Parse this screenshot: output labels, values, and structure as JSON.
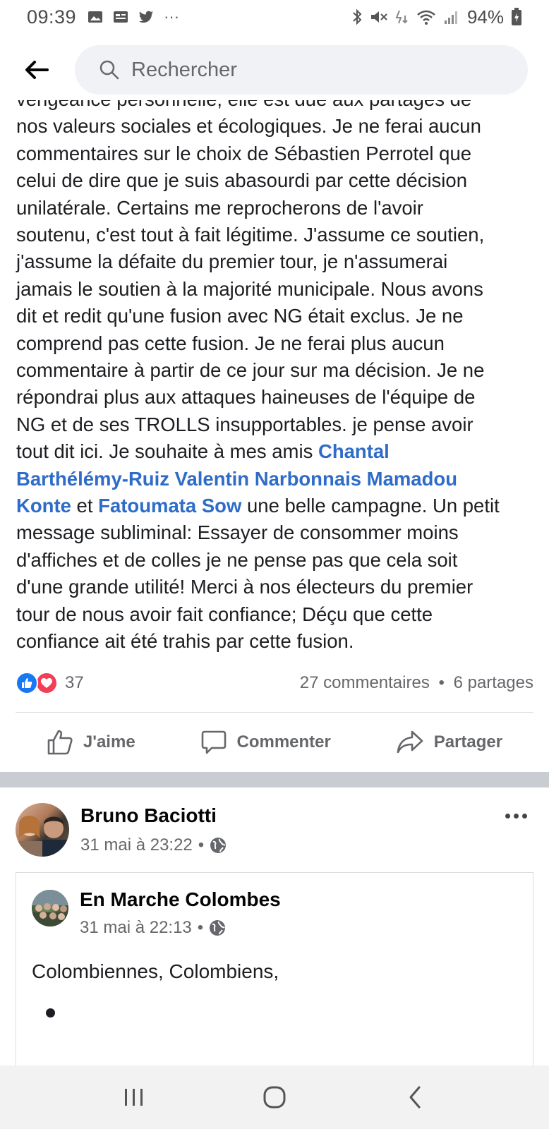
{
  "status_bar": {
    "time": "09:39",
    "left_icons": [
      "image-icon",
      "news-icon",
      "twitter-icon",
      "more-dots-icon"
    ],
    "more": "···",
    "right_icons": [
      "bluetooth-icon",
      "mute-icon",
      "data-icon",
      "wifi-icon",
      "signal-icon",
      "battery-icon"
    ],
    "battery": "94%"
  },
  "header": {
    "back_icon": "back-arrow-icon",
    "search_placeholder": "Rechercher",
    "search_icon": "search-icon"
  },
  "post1": {
    "clipped_line": "vengeance personnelle, elle est due aux partages de",
    "lines": [
      "nos valeurs sociales et écologiques. Je ne ferai aucun",
      "commentaires sur le choix de Sébastien Perrotel que",
      "celui de dire que je suis abasourdi par cette décision",
      "unilatérale. Certains me reprocherons de l'avoir",
      "soutenu, c'est tout à fait légitime. J'assume ce soutien,",
      "j'assume la défaite du premier tour, je n'assumerai",
      "jamais le soutien à la majorité municipale. Nous avons",
      "dit et redit qu'une fusion avec NG était exclus. Je ne",
      "comprend pas cette fusion. Je ne ferai plus aucun",
      "commentaire à partir de ce jour sur ma décision. Je ne",
      "répondrai plus aux attaques haineuses de l'équipe de",
      "NG et de ses TROLLS insupportables. je pense avoir"
    ],
    "line13_text": "tout dit ici. Je souhaite à mes amis ",
    "mention_1a": "Chantal",
    "mention_1b": "Barthélémy-Ruiz",
    "mention_2": "Valentin Narbonnais",
    "mention_3a": "Mamadou",
    "mention_3b": "Konte",
    "line16_and": " et ",
    "mention_4": "Fatoumata Sow",
    "line16_rest": " une belle campagne. Un petit",
    "tail_lines": [
      "message subliminal: Essayer de consommer moins",
      "d'affiches et de colles je ne pense pas que cela soit",
      "d'une grande utilité! Merci à nos électeurs du premier",
      "tour de nous avoir fait confiance; Déçu que cette",
      "confiance ait été trahis par cette fusion."
    ],
    "reaction_count": "37",
    "comments": "27 commentaires",
    "separator": "•",
    "shares": "6 partages",
    "like_label": "J'aime",
    "comment_label": "Commenter",
    "share_label": "Partager"
  },
  "post2": {
    "author": "Bruno Baciotti",
    "date": "31 mai à 23:22",
    "meta_sep": "•",
    "privacy_icon": "globe-icon",
    "more_icon": "more-options-icon",
    "shared": {
      "author": "En Marche Colombes",
      "date": "31 mai à 22:13",
      "meta_sep": "•",
      "text": "Colombiennes, Colombiens,"
    }
  },
  "navbar": {
    "icons": [
      "recent-apps-icon",
      "home-icon",
      "back-icon"
    ]
  },
  "colors": {
    "mention": "#2e6cc8",
    "like_blue": "#1877f2",
    "love_red": "#f33e58",
    "meta_grey": "#65676b",
    "separator_grey": "#c9ccd1"
  }
}
